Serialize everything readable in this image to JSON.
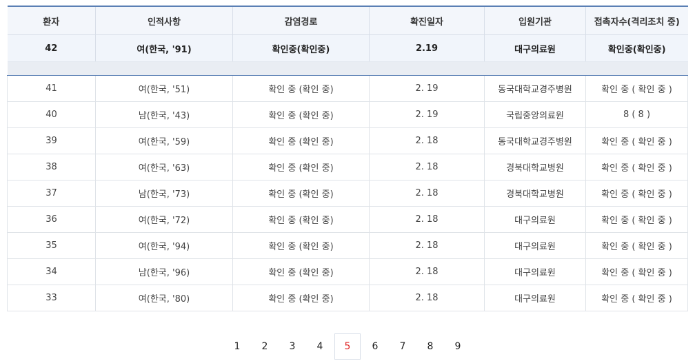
{
  "table": {
    "headers": [
      "환자",
      "인적사항",
      "감염경로",
      "확진일자",
      "입원기관",
      "접촉자수(격리조치 중)"
    ],
    "highlight_row": [
      "42",
      "여(한국, '91)",
      "확인중(확인중)",
      "2.19",
      "대구의료원",
      "확인중(확인중)"
    ],
    "rows": [
      [
        "41",
        "여(한국, '51)",
        "확인 중 (확인 중)",
        "2. 19",
        "동국대학교경주병원",
        "확인 중 ( 확인 중 )"
      ],
      [
        "40",
        "남(한국, '43)",
        "확인 중 (확인 중)",
        "2. 19",
        "국립중앙의료원",
        "8 ( 8 )"
      ],
      [
        "39",
        "여(한국, '59)",
        "확인 중 (확인 중)",
        "2. 18",
        "동국대학교경주병원",
        "확인 중 ( 확인 중 )"
      ],
      [
        "38",
        "여(한국, '63)",
        "확인 중 (확인 중)",
        "2. 18",
        "경북대학교병원",
        "확인 중 ( 확인 중 )"
      ],
      [
        "37",
        "남(한국, '73)",
        "확인 중 (확인 중)",
        "2. 18",
        "경북대학교병원",
        "확인 중 ( 확인 중 )"
      ],
      [
        "36",
        "여(한국, '72)",
        "확인 중 (확인 중)",
        "2. 18",
        "대구의료원",
        "확인 중 ( 확인 중 )"
      ],
      [
        "35",
        "여(한국, '94)",
        "확인 중 (확인 중)",
        "2. 18",
        "대구의료원",
        "확인 중 ( 확인 중 )"
      ],
      [
        "34",
        "남(한국, '96)",
        "확인 중 (확인 중)",
        "2. 18",
        "대구의료원",
        "확인 중 ( 확인 중 )"
      ],
      [
        "33",
        "여(한국, '80)",
        "확인 중 (확인 중)",
        "2. 18",
        "대구의료원",
        "확인 중 ( 확인 중 )"
      ]
    ]
  },
  "pagination": {
    "pages": [
      "1",
      "2",
      "3",
      "4",
      "5",
      "6",
      "7",
      "8",
      "9"
    ],
    "current": "5",
    "active_color": "#e02424"
  }
}
